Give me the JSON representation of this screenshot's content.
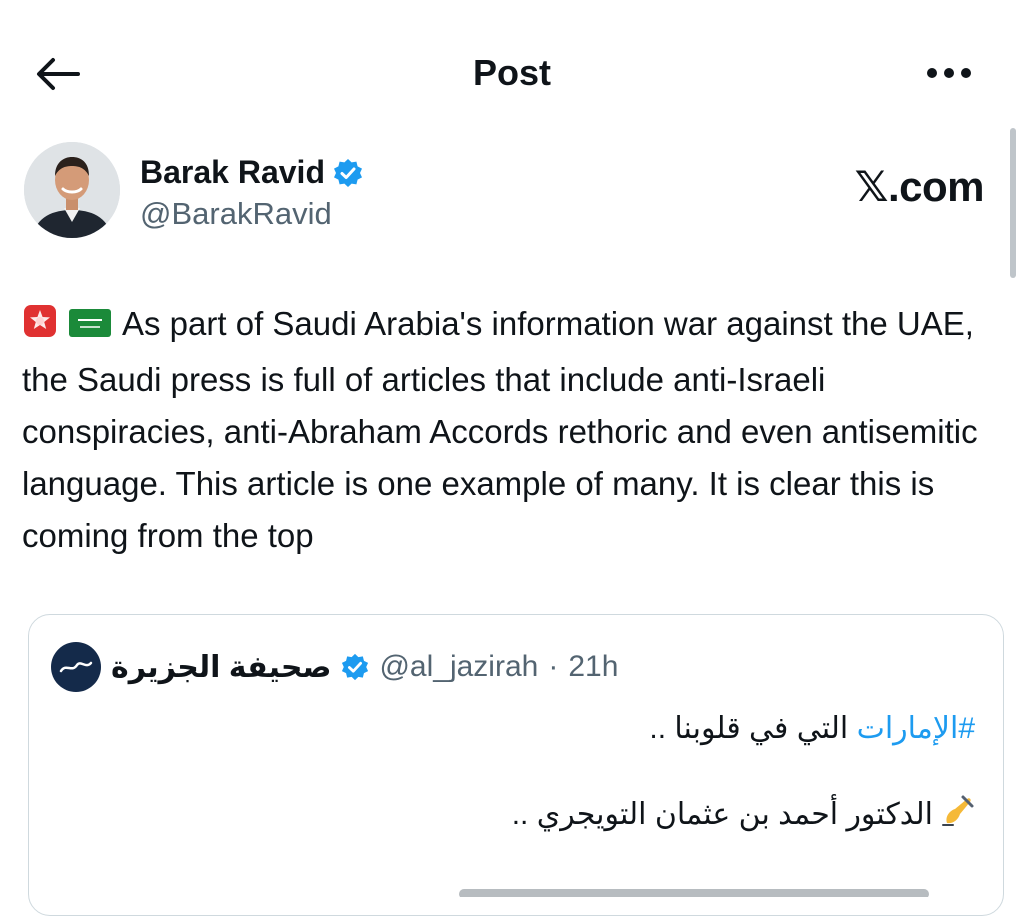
{
  "header": {
    "title": "Post",
    "back_icon": "arrow-left-icon",
    "more_icon": "more-horizontal-icon"
  },
  "author": {
    "name": "Barak Ravid",
    "handle": "@BarakRavid",
    "verified": true
  },
  "watermark": "𝕏.com",
  "post": {
    "emojis": [
      "rotating-light-emoji",
      "saudi-arabia-flag-emoji"
    ],
    "text": "As part of Saudi Arabia's information war against the UAE, the Saudi press is full of articles that include anti-Israeli conspiracies, anti-Abraham Accords rethoric and even antisemitic language. This article is one example of many. It is clear this is coming from the top"
  },
  "quoted": {
    "name": "صحيفة الجزيرة",
    "handle": "@al_jazirah",
    "separator": "·",
    "time": "21h",
    "hashtag": "#الإمارات",
    "line1_rest": " التي في قلوبنا ..",
    "line2_emoji": "writing-hand-emoji",
    "line2": "الدكتور أحمد بن عثمان التويجري .."
  },
  "colors": {
    "accent": "#1d9bf0",
    "text": "#0f1419",
    "secondary": "#536471",
    "border": "#cfd9de"
  }
}
